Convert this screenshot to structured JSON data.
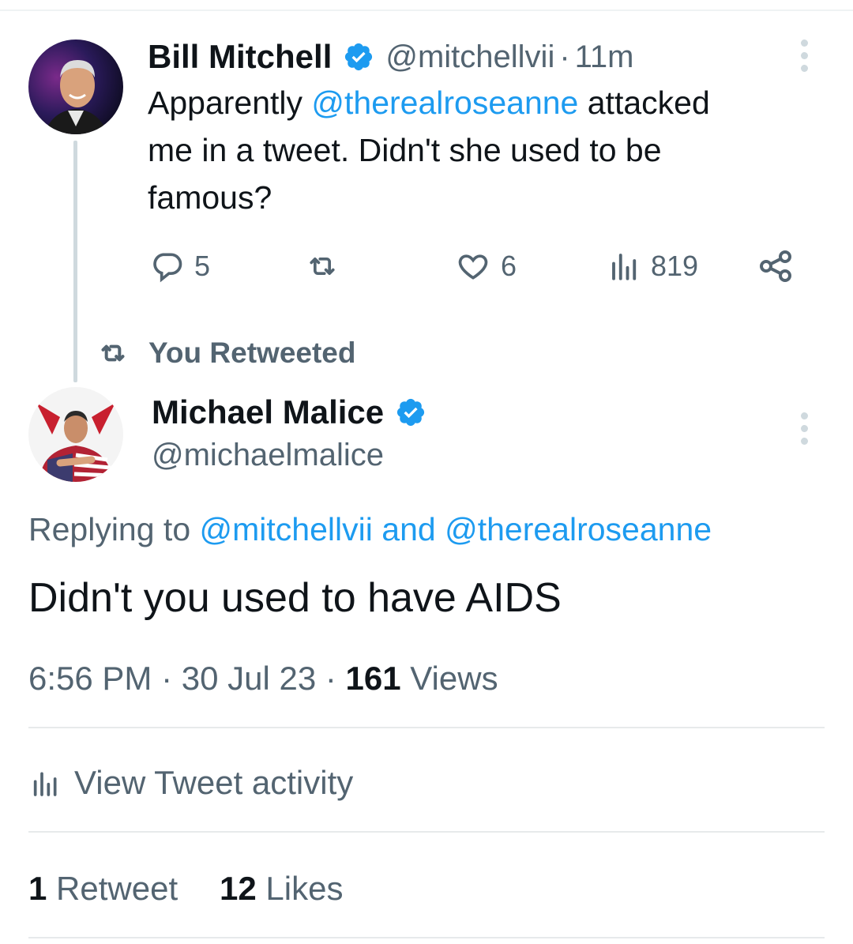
{
  "tweet1": {
    "name": "Bill Mitchell",
    "handle": "@mitchellvii",
    "separator": "·",
    "time": "11m",
    "text_part1": "Apparently ",
    "mention": "@therealroseanne",
    "text_part2": " attacked",
    "text_line2": "me in a tweet.  Didn't she used to be",
    "text_line3": "famous?",
    "reply_count": "5",
    "like_count": "6",
    "view_count": "819"
  },
  "retweet_label": "You Retweeted",
  "tweet2": {
    "name": "Michael Malice",
    "handle": "@michaelmalice",
    "replying_prefix": "Replying to",
    "replying_mention1": "@mitchellvii",
    "replying_and": "and",
    "replying_mention2": "@therealroseanne",
    "text": "Didn't you used to have AIDS",
    "time": "6:56 PM",
    "date": "30 Jul 23",
    "views_count": "161",
    "views_label": "Views",
    "activity_label": "View Tweet activity",
    "retweet_count": "1",
    "retweet_label": "Retweet",
    "likes_count": "12",
    "likes_label": "Likes"
  },
  "colors": {
    "accent": "#1d9bf0",
    "secondary_text": "#536471",
    "primary_text": "#0f1419"
  },
  "icons": [
    "verified-badge-icon",
    "more-icon",
    "reply-icon",
    "retweet-icon",
    "like-icon",
    "views-icon",
    "share-icon",
    "analytics-icon"
  ]
}
